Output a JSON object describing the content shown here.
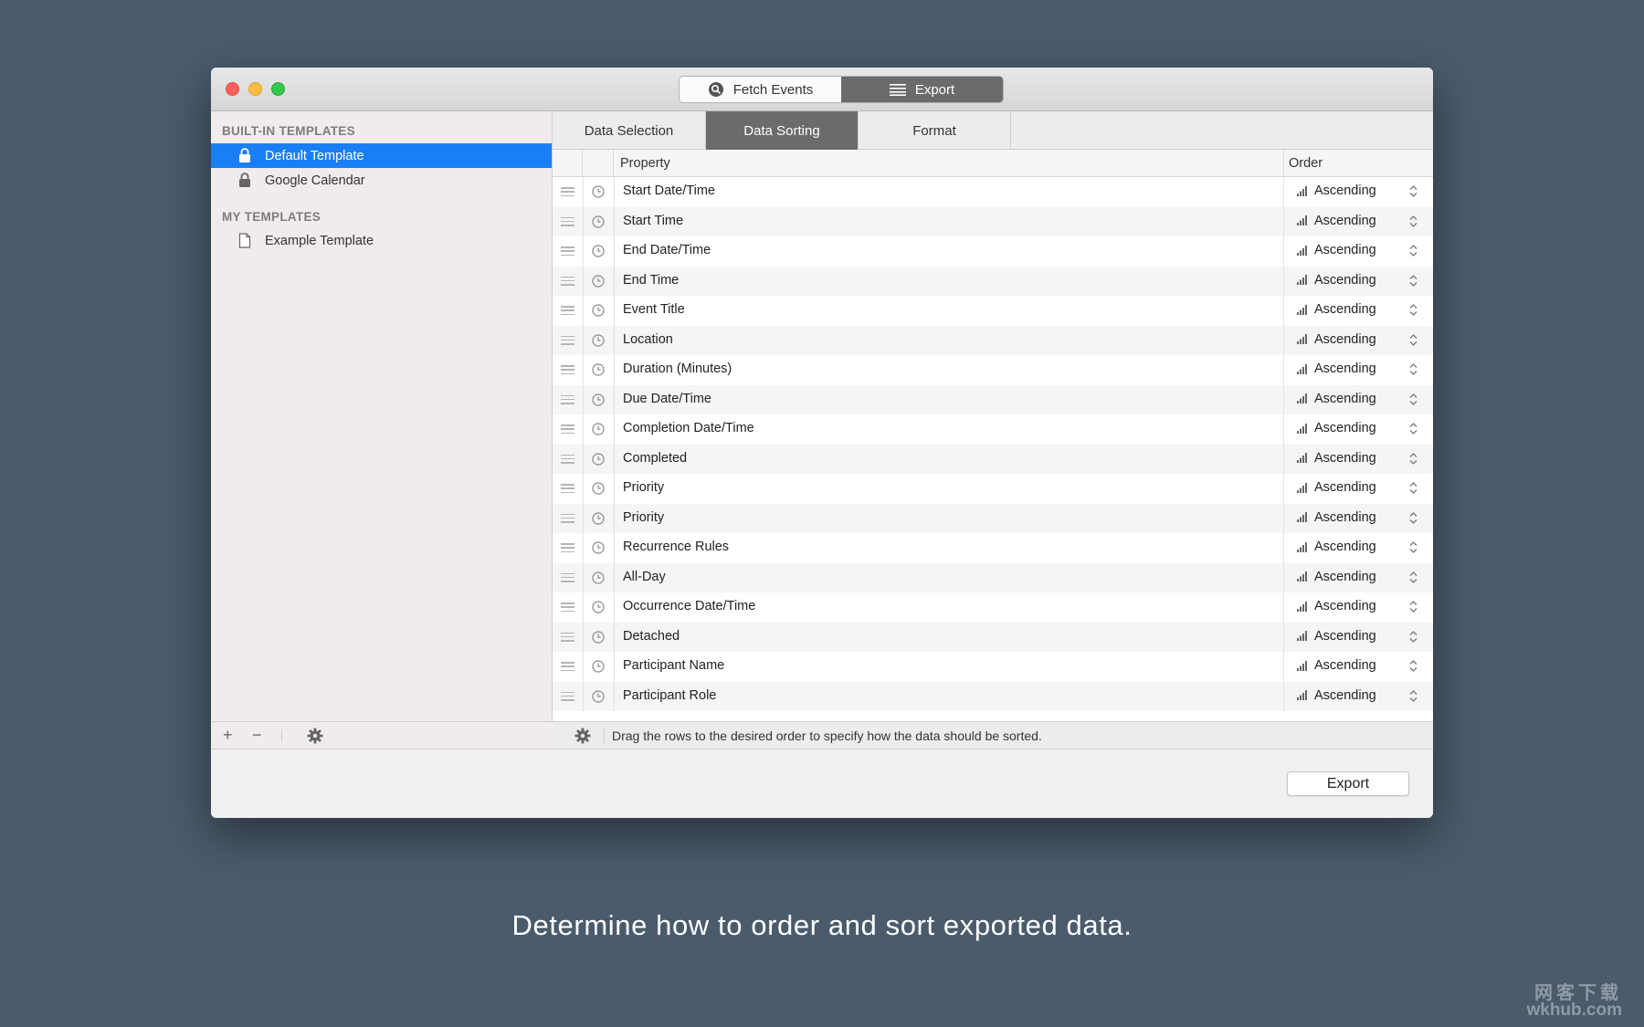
{
  "window": {
    "segmented": [
      {
        "label": "Fetch Events",
        "icon": "search-icon",
        "active": false
      },
      {
        "label": "Export",
        "icon": "list-icon",
        "active": true
      }
    ]
  },
  "sidebar": {
    "builtin_header": "BUILT-IN TEMPLATES",
    "builtin_items": [
      {
        "label": "Default Template",
        "icon": "lock-icon",
        "selected": true
      },
      {
        "label": "Google Calendar",
        "icon": "lock-icon",
        "selected": false
      }
    ],
    "my_header": "MY TEMPLATES",
    "my_items": [
      {
        "label": "Example Template",
        "icon": "document-icon",
        "selected": false
      }
    ],
    "footer": {
      "add": "+",
      "remove": "−"
    }
  },
  "tabs": [
    {
      "label": "Data Selection",
      "active": false
    },
    {
      "label": "Data Sorting",
      "active": true
    },
    {
      "label": "Format",
      "active": false
    }
  ],
  "table": {
    "columns": {
      "property": "Property",
      "order": "Order"
    },
    "rows": [
      {
        "property": "Start Date/Time",
        "order": "Ascending"
      },
      {
        "property": "Start Time",
        "order": "Ascending"
      },
      {
        "property": "End Date/Time",
        "order": "Ascending"
      },
      {
        "property": "End Time",
        "order": "Ascending"
      },
      {
        "property": "Event Title",
        "order": "Ascending"
      },
      {
        "property": "Location",
        "order": "Ascending"
      },
      {
        "property": "Duration (Minutes)",
        "order": "Ascending"
      },
      {
        "property": "Due Date/Time",
        "order": "Ascending"
      },
      {
        "property": "Completion Date/Time",
        "order": "Ascending"
      },
      {
        "property": "Completed",
        "order": "Ascending"
      },
      {
        "property": "Priority",
        "order": "Ascending"
      },
      {
        "property": "Priority",
        "order": "Ascending"
      },
      {
        "property": "Recurrence Rules",
        "order": "Ascending"
      },
      {
        "property": "All-Day",
        "order": "Ascending"
      },
      {
        "property": "Occurrence Date/Time",
        "order": "Ascending"
      },
      {
        "property": "Detached",
        "order": "Ascending"
      },
      {
        "property": "Participant Name",
        "order": "Ascending"
      },
      {
        "property": "Participant Role",
        "order": "Ascending"
      }
    ],
    "footer_hint": "Drag the rows to the desired order to specify how the data should be sorted."
  },
  "export_button": "Export",
  "caption": "Determine how to order and sort exported data.",
  "watermark": {
    "cn": "网客下载",
    "en": "wkhub.com"
  },
  "colors": {
    "background": "#4a5b6c",
    "selection": "#1a7ff5",
    "active_tab": "#6b6b6b"
  }
}
